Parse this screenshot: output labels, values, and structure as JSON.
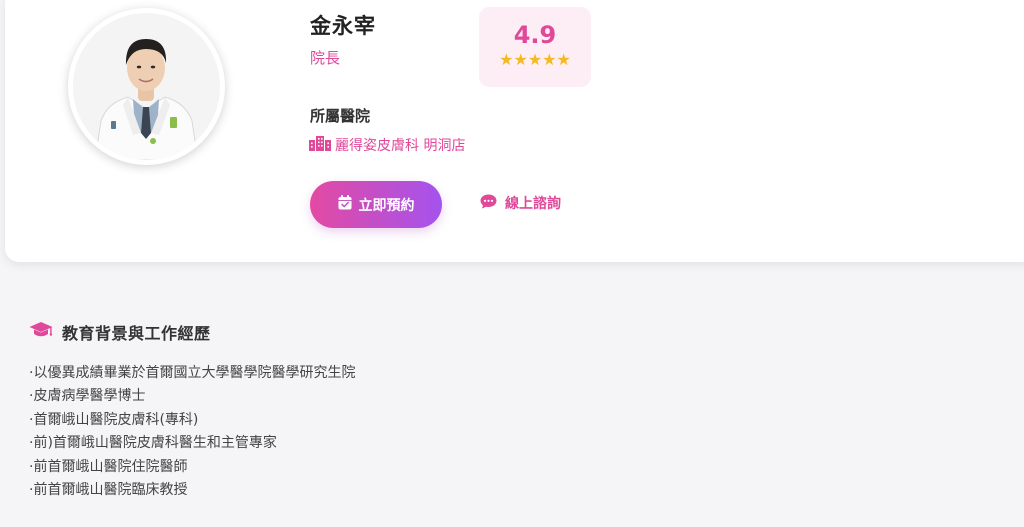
{
  "doctor": {
    "name": "金永宰",
    "title": "院長",
    "rating": "4.9",
    "stars": "★★★★★"
  },
  "hospital": {
    "label": "所屬醫院",
    "name": "麗得姿皮膚科 明洞店"
  },
  "actions": {
    "book_label": "立即預約",
    "consult_label": "線上諮詢"
  },
  "education": {
    "title": "教育背景與工作經歷",
    "items": [
      "·以優異成績畢業於首爾國立大學醫學院醫學研究生院",
      "·皮膚病學醫學博士",
      "·首爾峨山醫院皮膚科(專科)",
      "·前)首爾峨山醫院皮膚科醫生和主管專家",
      "·前首爾峨山醫院住院醫師",
      "·前首爾峨山醫院臨床教授"
    ]
  },
  "colors": {
    "accent": "#e0489a",
    "gradient_start": "#e34aa2",
    "gradient_end": "#a453ee",
    "star": "#f5b921"
  },
  "icons": {
    "hospital": "building-icon",
    "book": "calendar-check-icon",
    "consult": "chat-bubble-icon",
    "education": "graduation-cap-icon"
  }
}
